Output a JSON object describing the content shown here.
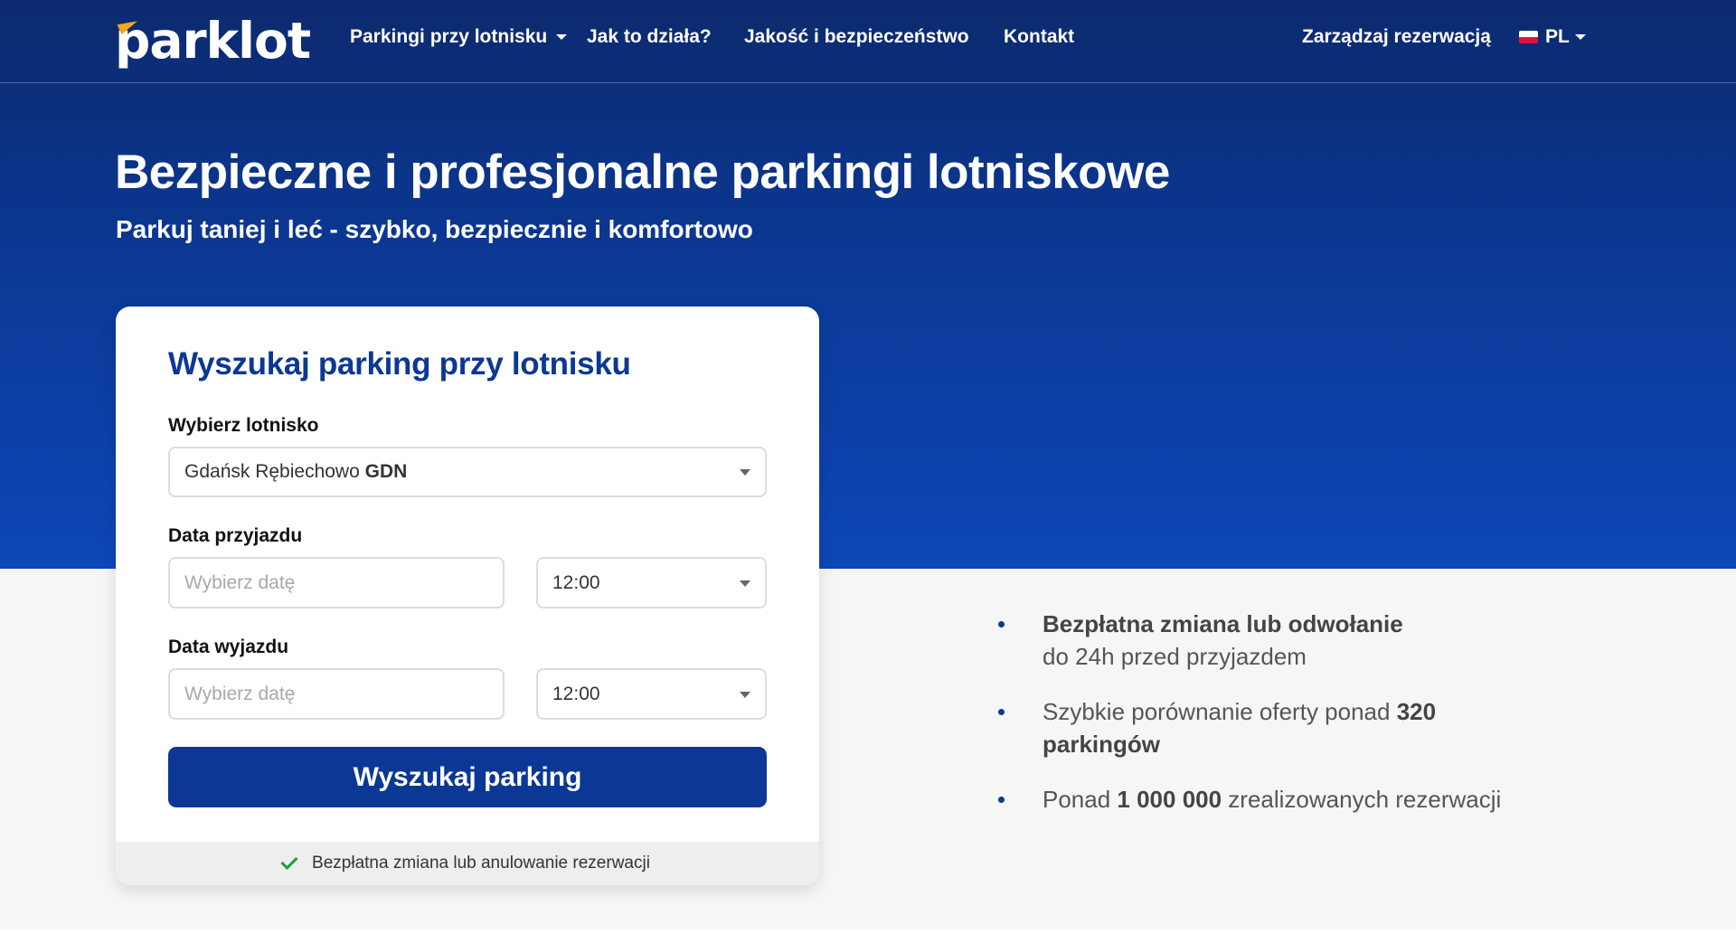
{
  "brand": {
    "logo_text": "parklot"
  },
  "nav": {
    "items": [
      {
        "label": "Parkingi przy lotnisku",
        "has_dropdown": true
      },
      {
        "label": "Jak to działa?"
      },
      {
        "label": "Jakość i bezpieczeństwo"
      },
      {
        "label": "Kontakt"
      }
    ],
    "manage_reservation": "Zarządzaj rezerwacją",
    "language": "PL"
  },
  "hero": {
    "title": "Bezpieczne i profesjonalne parkingi lotniskowe",
    "subtitle": "Parkuj taniej i leć - szybko, bezpiecznie i komfortowo"
  },
  "search_form": {
    "title": "Wyszukaj parking przy lotnisku",
    "airport_label": "Wybierz lotnisko",
    "airport_value": {
      "name": "Gdańsk Rębiechowo",
      "code": "GDN"
    },
    "arrival_label": "Data przyjazdu",
    "arrival_date_placeholder": "Wybierz datę",
    "arrival_time": "12:00",
    "departure_label": "Data wyjazdu",
    "departure_date_placeholder": "Wybierz datę",
    "departure_time": "12:00",
    "submit_label": "Wyszukaj parking",
    "footer_note": "Bezpłatna zmiana lub anulowanie rezerwacji"
  },
  "benefits": [
    {
      "bold": "Bezpłatna zmiana lub odwołanie",
      "text": "do 24h przed przyjazdem"
    },
    {
      "text_before": "Szybkie porównanie oferty ponad ",
      "bold": "320 parkingów"
    },
    {
      "text_before": "Ponad ",
      "bold": "1 000 000",
      "text_after": " zrealizowanych rezerwacji"
    }
  ],
  "colors": {
    "primary": "#0b3894",
    "hero_top": "#0c2a6e",
    "hero_bottom": "#0d47b8",
    "check": "#1f9d3a",
    "page_bg": "#f6f6f6"
  }
}
